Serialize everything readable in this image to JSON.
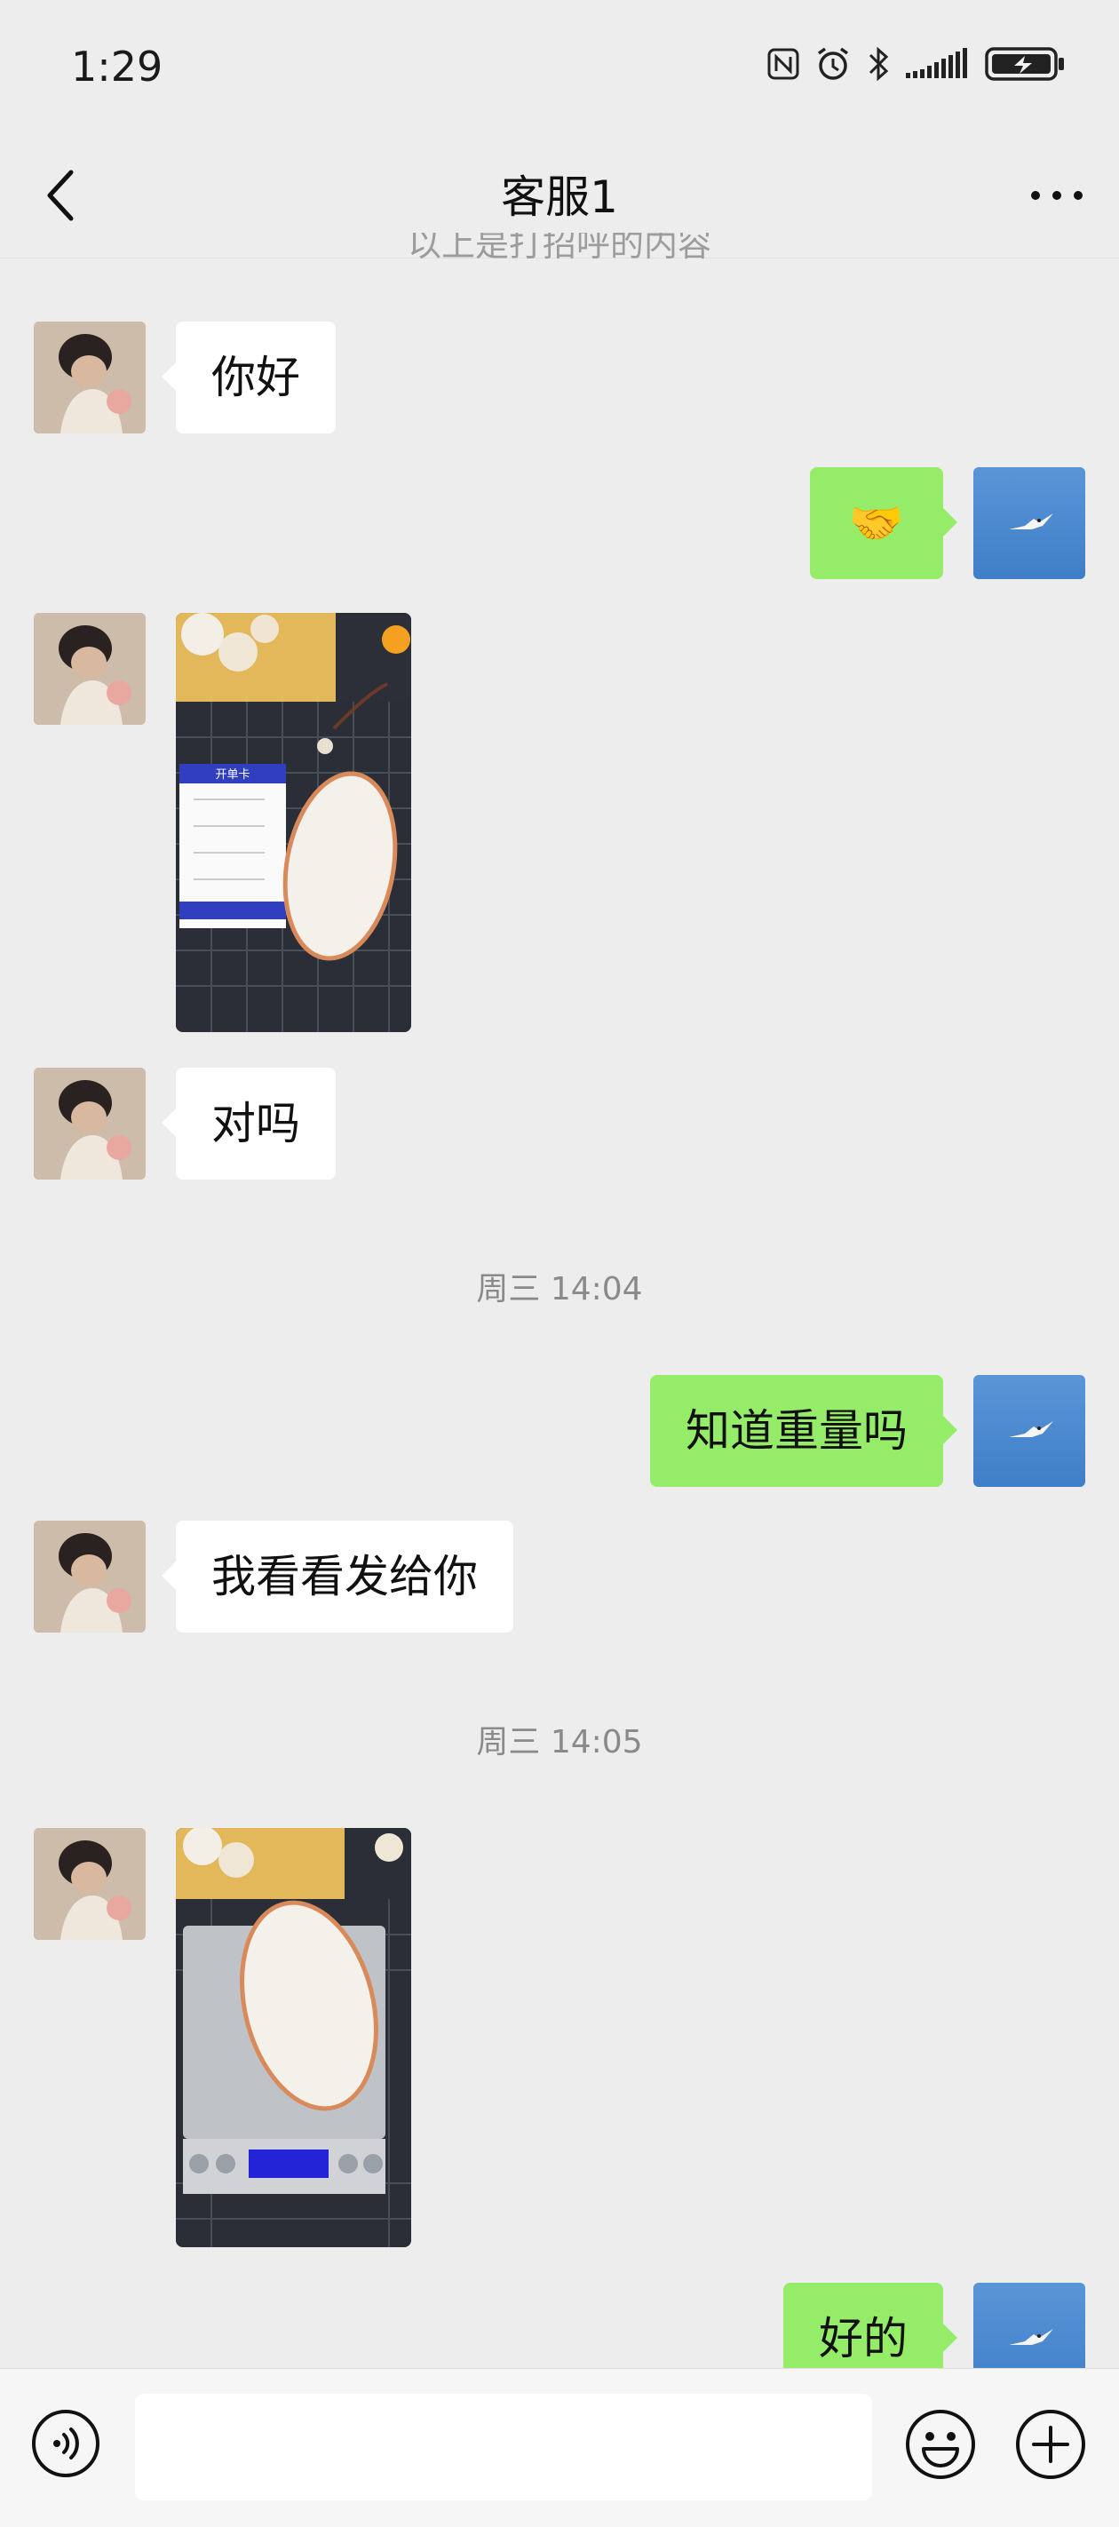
{
  "status": {
    "time": "1:29"
  },
  "nav": {
    "title": "客服1"
  },
  "chat": {
    "partial_text": "以上是打招呼的内容",
    "msg1": "你好",
    "msg2_emoji": "🤝",
    "msg3": "对吗",
    "ts1": "周三 14:04",
    "msg4": "知道重量吗",
    "msg5": "我看看发给你",
    "ts2": "周三 14:05",
    "msg6": "好的",
    "card_title": "开单卡"
  },
  "input": {
    "placeholder": ""
  },
  "icons": {
    "back": "chevron-left-icon",
    "more": "more-icon",
    "voice": "voice-icon",
    "emoji": "emoji-icon",
    "plus": "plus-icon"
  },
  "colors": {
    "bubble_me": "#95ec69",
    "bubble_other": "#ffffff",
    "background": "#ededed"
  }
}
